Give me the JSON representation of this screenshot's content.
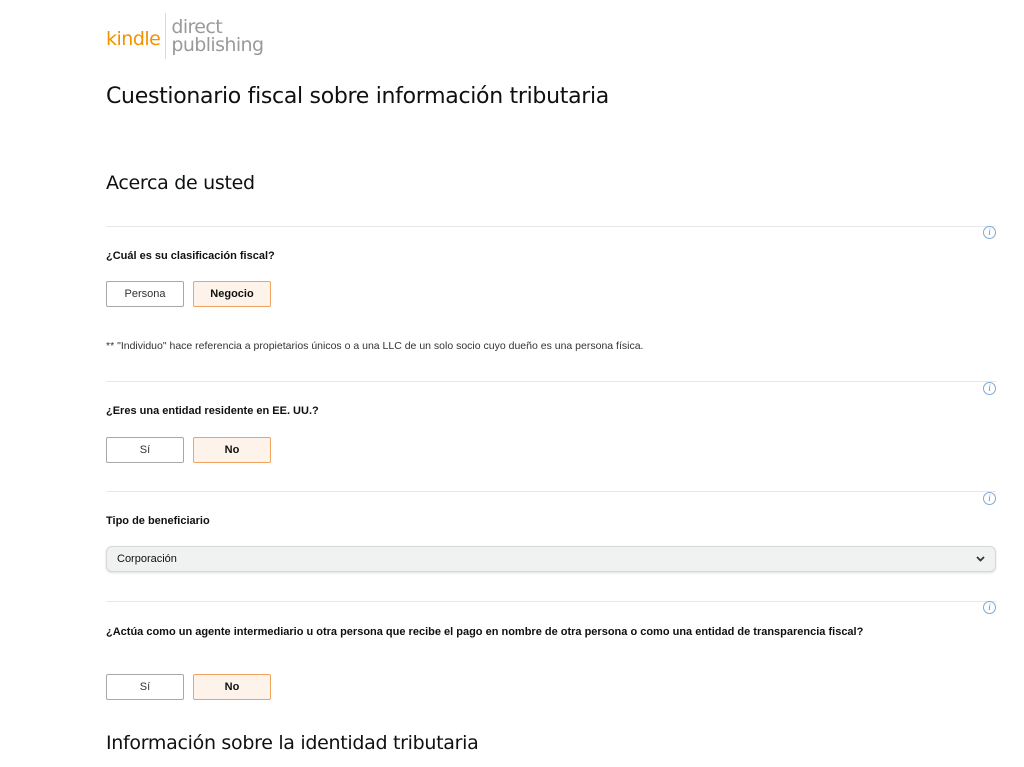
{
  "logo": {
    "kindle": "kindle",
    "direct": "direct",
    "publishing": "publishing"
  },
  "page_title": "Cuestionario fiscal sobre información tributaria",
  "sections": {
    "about_you": "Acerca de usted",
    "tax_identity": "Información sobre la identidad tributaria"
  },
  "info_icon_glyph": "i",
  "questions": {
    "classification": {
      "label": "¿Cuál es su clasificación fiscal?",
      "options": [
        "Persona",
        "Negocio"
      ],
      "selected": "Negocio",
      "note": "** \"Individuo\" hace referencia a propietarios únicos o a una LLC de un solo socio cuyo dueño es una persona física."
    },
    "us_resident": {
      "label": "¿Eres una entidad residente en EE. UU.?",
      "options": [
        "Sí",
        "No"
      ],
      "selected": "No"
    },
    "beneficiary_type": {
      "label": "Tipo de beneficiario",
      "value": "Corporación"
    },
    "intermediary": {
      "label": "¿Actúa como un agente intermediario u otra persona que recibe el pago en nombre de otra persona o como una entidad de transparencia fiscal?",
      "options": [
        "Sí",
        "No"
      ],
      "selected": "No"
    }
  },
  "colors": {
    "brand_orange": "#f39200",
    "selected_bg": "#fdf3ea",
    "selected_border": "#f0a35c",
    "info_blue": "#4a8ad0"
  }
}
